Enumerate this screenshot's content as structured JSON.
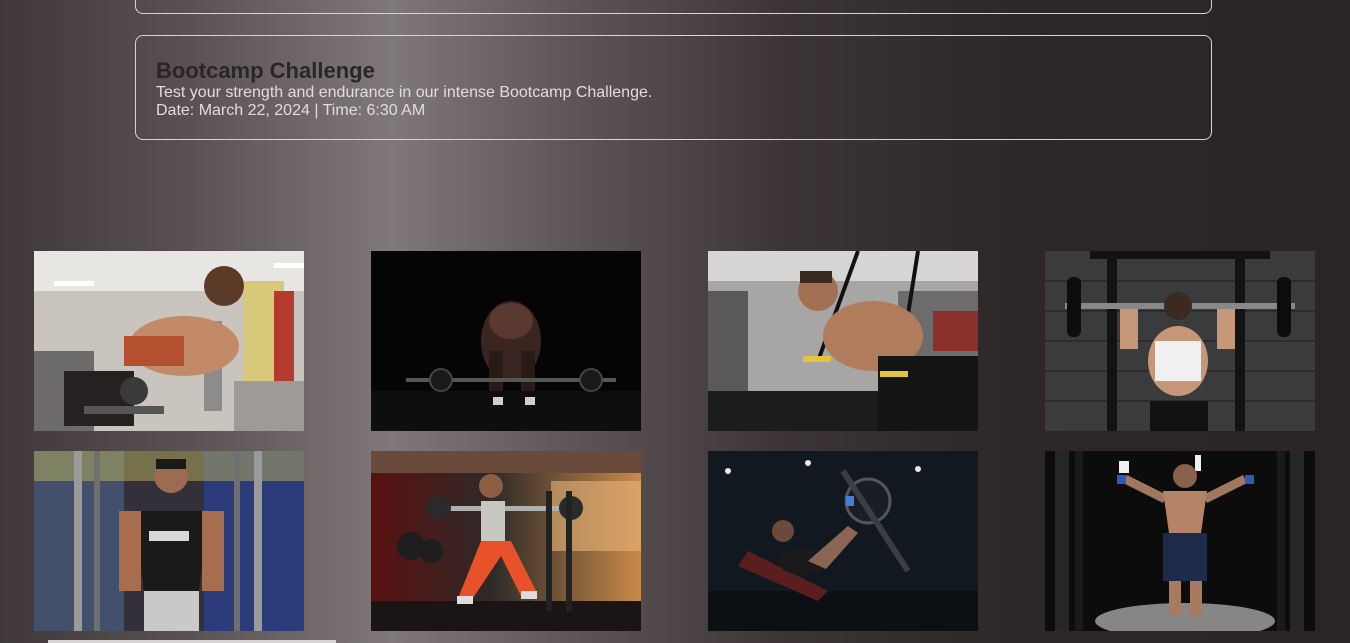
{
  "events": [
    {
      "title": "Bootcamp Challenge",
      "description": "Test your strength and endurance in our intense Bootcamp Challenge.",
      "date_time": "Date: March 22, 2024 | Time: 6:30 AM"
    }
  ],
  "gallery": [
    {
      "subject": "woman-dumbbell-row"
    },
    {
      "subject": "man-deadlift-dark"
    },
    {
      "subject": "man-suspension-trainer"
    },
    {
      "subject": "woman-barbell-press-back"
    },
    {
      "subject": "man-cable-crossover"
    },
    {
      "subject": "woman-barbell-lunge"
    },
    {
      "subject": "woman-leg-press"
    },
    {
      "subject": "man-arms-raised-gym"
    }
  ],
  "colors": {
    "card_border": "#d9d4d4",
    "title": "#2b2626",
    "text": "#e2dddd"
  }
}
